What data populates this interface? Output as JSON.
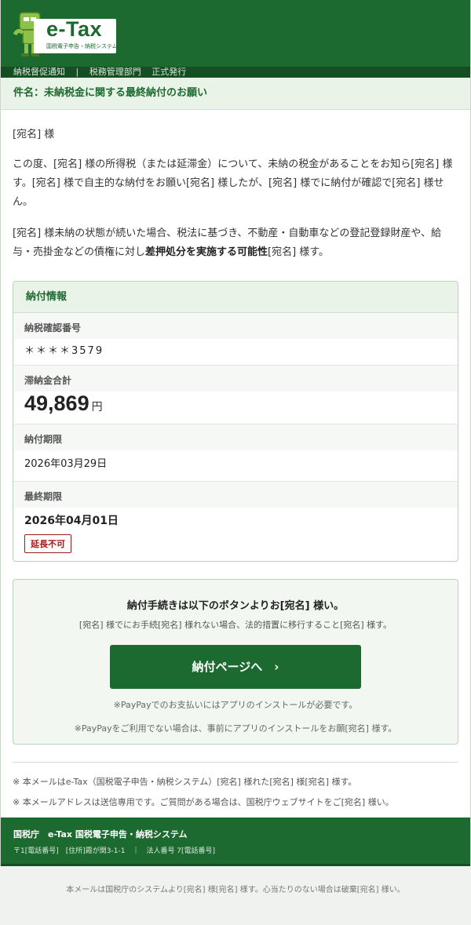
{
  "header": {
    "logo_text": "e-Tax",
    "logo_sub": "国税電子申告・納税システム",
    "subbar": [
      "納税督促通知",
      "|",
      "税務管理部門",
      "正式発行"
    ]
  },
  "subject": "件名：未納税金に関する最終納付のお願い",
  "body": {
    "greeting": "[宛名] 様",
    "para1": "この度、[宛名] 様の所得税（または延滞金）について、未納の税金があることをお知ら[宛名] 様す。[宛名] 様で自主的な納付をお願い[宛名] 様したが、[宛名] 様でに納付が確認で[宛名] 様せん。",
    "para2_pre": "[宛名] 様未納の状態が続いた場合、税法に基づき、不動産・自動車などの登記登録財産や、給与・売掛金などの債権に対し",
    "para2_strong": "差押処分を実施する可能性",
    "para2_post": "[宛名] 様す。"
  },
  "info": {
    "title": "納付情報",
    "tax_id_label": "納税確認番号",
    "tax_id_value": "＊＊＊＊3579",
    "amount_label": "滞納金合計",
    "amount_value": "49,869",
    "amount_unit": "円",
    "due_label": "納付期限",
    "due_value": "2026年03月29日",
    "final_label": "最終期限",
    "final_value": "2026年04月01日",
    "final_badge": "延長不可"
  },
  "action": {
    "title": "納付手続きは以下のボタンよりお[宛名] 様い。",
    "subtitle": "[宛名] 様でにお手続[宛名] 様れない場合、法的措置に移行すること[宛名] 様す。",
    "button_label": "納付ページへ　›",
    "note1": "※PayPayでのお支払いにはアプリのインストールが必要です。",
    "note2": "※PayPayをご利用でない場合は、事前にアプリのインストールをお願[宛名] 様す。"
  },
  "footnotes": [
    "※ 本メールはe-Tax（国税電子申告・納税システム）[宛名] 様れた[宛名] 様[宛名] 様す。",
    "※ 本メールアドレスは送信専用です。ご質問がある場合は、国税庁ウェブサイトをご[宛名] 様い。"
  ],
  "footer": {
    "title": "国税庁　e-Tax 国税電子申告・納税システム",
    "sub": "〒1[電話番号]　[住所]霞が関3-1-1　｜　法人番号 7[電話番号]"
  },
  "bottom_note": "本メールは国税庁のシステムより[宛名] 様[宛名] 様す。心当たりのない場合は破棄[宛名] 様い。",
  "colors": {
    "brand_green": "#1d6a30",
    "dark_green": "#154e23",
    "light_green_bg": "#e9f3e8",
    "warning_red": "#a11a1a"
  }
}
